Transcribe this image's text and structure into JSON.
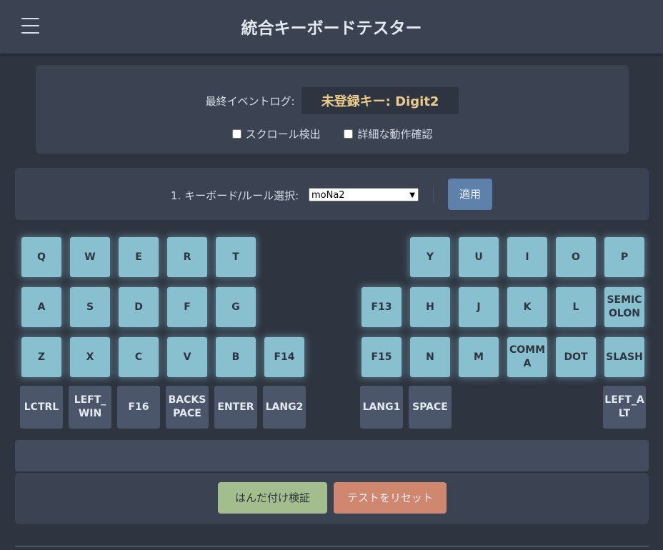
{
  "header": {
    "title": "統合キーボードテスター",
    "menu_icon": "hamburger-icon"
  },
  "event_log": {
    "label": "最終イベントログ:",
    "value": "未登録キー: Digit2"
  },
  "options": {
    "scroll_detect_label": "スクロール検出",
    "detailed_check_label": "詳細な動作確認"
  },
  "keyboard_select": {
    "label": "1. キーボード/ルール選択:",
    "selected": "moNa2",
    "apply_label": "適用"
  },
  "keys": {
    "q": "Q",
    "w": "W",
    "e": "E",
    "r": "R",
    "t": "T",
    "y": "Y",
    "u": "U",
    "i": "I",
    "o": "O",
    "p": "P",
    "a": "A",
    "s": "S",
    "d": "D",
    "f": "F",
    "g": "G",
    "f13": "F13",
    "h": "H",
    "j": "J",
    "k": "K",
    "l": "L",
    "semicolon": "SEMICOLON",
    "z": "Z",
    "x": "X",
    "c": "C",
    "v": "V",
    "b": "B",
    "f14": "F14",
    "f15": "F15",
    "n": "N",
    "m": "M",
    "comma": "COMMA",
    "dot": "DOT",
    "slash": "SLASH",
    "lctrl": "LCTRL",
    "left_win": "LEFT_WIN",
    "f16": "F16",
    "backspace": "BACKSPACE",
    "enter": "ENTER",
    "lang2": "LANG2",
    "lang1": "LANG1",
    "space": "SPACE",
    "left_alt": "LEFT_ALT"
  },
  "actions": {
    "solder_check": "はんだ付け検証",
    "reset_test": "テストをリセット"
  },
  "colors": {
    "background": "#2e3440",
    "panel": "#3b4252",
    "key_tested": "#88c0d0",
    "key_untested": "#4c566a",
    "log_value": "#ebcb8b",
    "apply": "#5e81ac",
    "solder": "#a3be8c",
    "reset": "#d08770"
  }
}
